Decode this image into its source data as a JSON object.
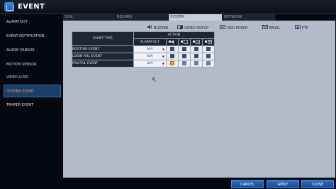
{
  "window": {
    "title": "EVENT"
  },
  "sidebar": {
    "items": [
      {
        "label": "ALARM OUT"
      },
      {
        "label": "EVENT NOTIFICATION"
      },
      {
        "label": "ALARM SENSOR"
      },
      {
        "label": "MOTION SENSOR"
      },
      {
        "label": "VIDEO LOSS"
      },
      {
        "label": "SYSTEM EVENT",
        "active": true
      },
      {
        "label": "TAMPER EVENT"
      }
    ]
  },
  "tabs": [
    {
      "label": "DISK"
    },
    {
      "label": "RECORD"
    },
    {
      "label": "SYSTEM",
      "active": true
    },
    {
      "label": "NETWORK"
    }
  ],
  "legend": {
    "buzzer": "BUZZER",
    "video_popup": "VIDEO POPUP",
    "osd_popup": "OSD POPUP",
    "email": "EMAIL",
    "ftp": "FTP"
  },
  "table": {
    "col_event_type": "EVENT TYPE",
    "col_action": "ACTION",
    "col_alarm_out": "ALARM OUT",
    "rows": [
      {
        "name": "BOOTING EVENT",
        "alarm_out": "N/A",
        "checks": [
          "off",
          "off",
          "off",
          "off"
        ]
      },
      {
        "name": "LOGIN FAIL EVENT",
        "alarm_out": "N/A",
        "checks": [
          "off",
          "off",
          "off",
          "off"
        ]
      },
      {
        "name": "FAN FAIL EVENT",
        "alarm_out": "N/A",
        "checks": [
          "on",
          "grey",
          "grey",
          "grey"
        ]
      }
    ]
  },
  "buttons": {
    "cancel": "CANCEL",
    "apply": "APPLY",
    "close": "CLOSE"
  }
}
